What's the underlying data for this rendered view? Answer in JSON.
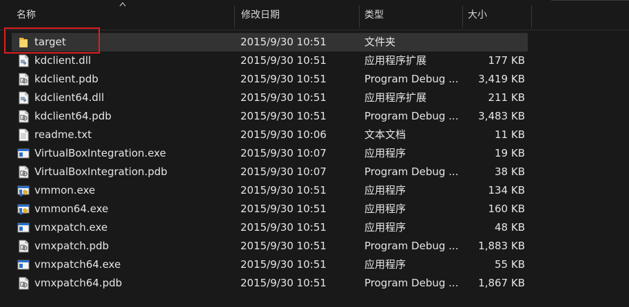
{
  "columns": {
    "name": "名称",
    "date": "修改日期",
    "type": "类型",
    "size": "大小"
  },
  "files": [
    {
      "name": "target",
      "date": "2015/9/30 10:51",
      "type": "文件夹",
      "size": "",
      "icon": "folder-icon"
    },
    {
      "name": "kdclient.dll",
      "date": "2015/9/30 10:51",
      "type": "应用程序扩展",
      "size": "177 KB",
      "icon": "dll-file-icon"
    },
    {
      "name": "kdclient.pdb",
      "date": "2015/9/30 10:51",
      "type": "Program Debug ...",
      "size": "3,419 KB",
      "icon": "pdb-file-icon"
    },
    {
      "name": "kdclient64.dll",
      "date": "2015/9/30 10:51",
      "type": "应用程序扩展",
      "size": "211 KB",
      "icon": "dll-file-icon"
    },
    {
      "name": "kdclient64.pdb",
      "date": "2015/9/30 10:51",
      "type": "Program Debug ...",
      "size": "3,483 KB",
      "icon": "pdb-file-icon"
    },
    {
      "name": "readme.txt",
      "date": "2015/9/30 10:06",
      "type": "文本文档",
      "size": "11 KB",
      "icon": "text-file-icon"
    },
    {
      "name": "VirtualBoxIntegration.exe",
      "date": "2015/9/30 10:07",
      "type": "应用程序",
      "size": "19 KB",
      "icon": "exe-window-icon"
    },
    {
      "name": "VirtualBoxIntegration.pdb",
      "date": "2015/9/30 10:07",
      "type": "Program Debug ...",
      "size": "38 KB",
      "icon": "pdb-file-icon"
    },
    {
      "name": "vmmon.exe",
      "date": "2015/9/30 10:51",
      "type": "应用程序",
      "size": "134 KB",
      "icon": "vmmon-app-icon"
    },
    {
      "name": "vmmon64.exe",
      "date": "2015/9/30 10:51",
      "type": "应用程序",
      "size": "160 KB",
      "icon": "vmmon-app-icon"
    },
    {
      "name": "vmxpatch.exe",
      "date": "2015/9/30 10:51",
      "type": "应用程序",
      "size": "48 KB",
      "icon": "exe-window-icon"
    },
    {
      "name": "vmxpatch.pdb",
      "date": "2015/9/30 10:51",
      "type": "Program Debug ...",
      "size": "1,883 KB",
      "icon": "pdb-file-icon"
    },
    {
      "name": "vmxpatch64.exe",
      "date": "2015/9/30 10:51",
      "type": "应用程序",
      "size": "55 KB",
      "icon": "exe-window-icon"
    },
    {
      "name": "vmxpatch64.pdb",
      "date": "2015/9/30 10:51",
      "type": "Program Debug ...",
      "size": "1,867 KB",
      "icon": "pdb-file-icon"
    }
  ],
  "colors": {
    "background": "#191919",
    "selected_row": "#333333",
    "highlight_box": "#e01e1e",
    "folder": "#f5c342"
  }
}
